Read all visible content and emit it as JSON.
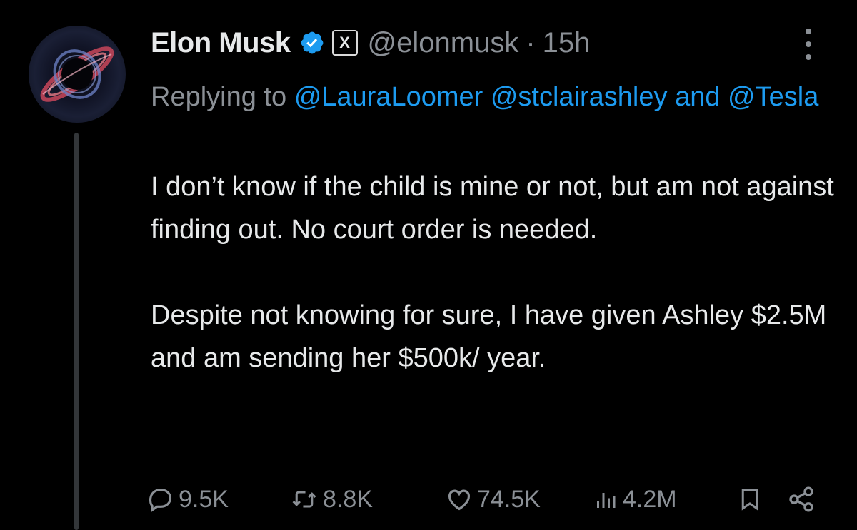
{
  "author": {
    "display_name": "Elon Musk",
    "handle": "@elonmusk",
    "time_ago": "15h",
    "separator": "·",
    "verified_badge_icon": "verified-badge-icon",
    "affiliate_badge_letter": "X"
  },
  "reply_context": {
    "prefix": "Replying to",
    "mentions": [
      "@LauraLoomer",
      "@stclairashley",
      "@Tesla"
    ],
    "joiner": "and"
  },
  "tweet": {
    "text": "I don’t know if the child is mine or not, but am not against finding out. No court order is needed.\n\nDespite not knowing for sure, I have given Ashley $2.5M and am sending her $500k/ year."
  },
  "actions": {
    "replies": "9.5K",
    "retweets": "8.8K",
    "likes": "74.5K",
    "views": "4.2M"
  },
  "colors": {
    "background": "#000000",
    "text": "#e7e9ea",
    "secondary": "#8b9096",
    "link": "#1d9bf0",
    "verified": "#1d9bf0"
  },
  "icons": [
    "more-options-icon",
    "reply-icon",
    "retweet-icon",
    "like-icon",
    "views-icon",
    "bookmark-icon",
    "share-icon"
  ]
}
